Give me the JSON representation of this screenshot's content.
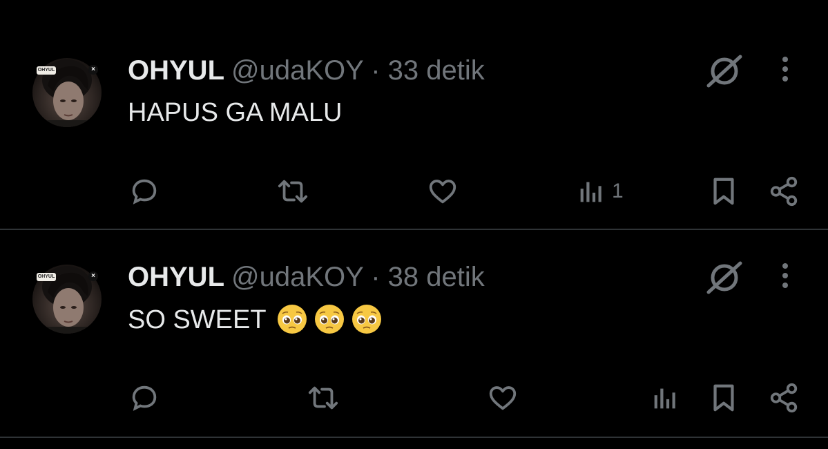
{
  "colors": {
    "background": "#000000",
    "text_primary": "#e7e9ea",
    "text_secondary": "#71767b",
    "divider": "#2f3336"
  },
  "tweets": [
    {
      "display_name": "OHYUL",
      "handle": "@udaKOY",
      "separator": "·",
      "time": "33 detik",
      "text": "HAPUS GA MALU",
      "avatar_badge": "OHYUL",
      "views": "1",
      "icons": [
        "reply-icon",
        "retweet-icon",
        "like-icon",
        "views-icon",
        "bookmark-icon",
        "share-icon",
        "grok-icon",
        "more-icon"
      ]
    },
    {
      "display_name": "OHYUL",
      "handle": "@udaKOY",
      "separator": "·",
      "time": "38 detik",
      "text": "SO SWEET",
      "avatar_badge": "OHYUL",
      "emojis": [
        "pleading-face-emoji",
        "pleading-face-emoji",
        "pleading-face-emoji"
      ],
      "views": "",
      "icons": [
        "reply-icon",
        "retweet-icon",
        "like-icon",
        "views-icon",
        "bookmark-icon",
        "share-icon",
        "grok-icon",
        "more-icon"
      ]
    }
  ]
}
